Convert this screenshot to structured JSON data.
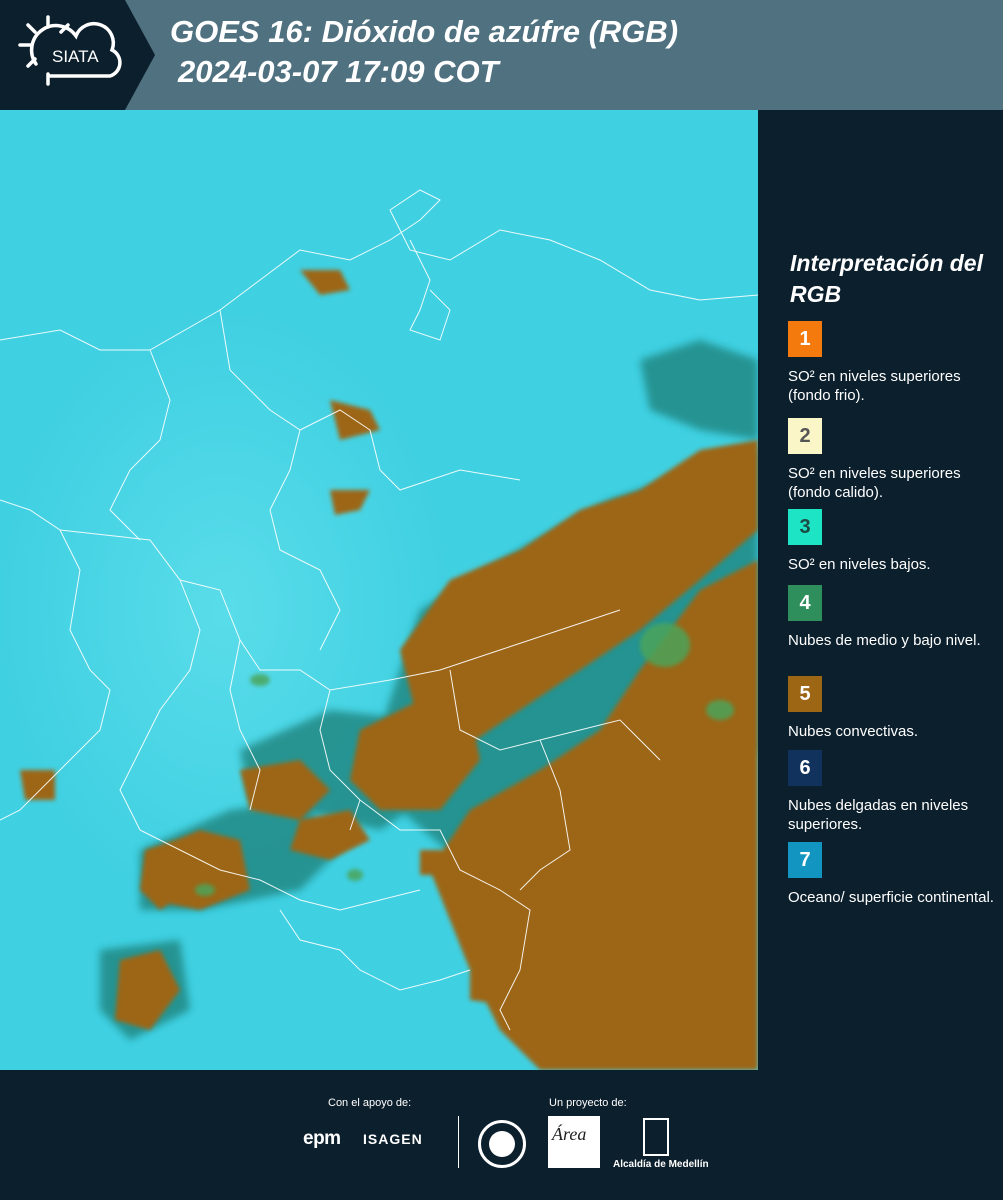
{
  "header": {
    "logo_text": "SIATA",
    "title_line1": "GOES 16: Dióxido de azúfre (RGB)",
    "title_line2": "2024-03-07 17:09 COT"
  },
  "legend": {
    "title": "Interpretación del RGB",
    "items": [
      {
        "number": "1",
        "color": "#f47a0e",
        "number_color": "#ffffff",
        "text": "SO² en niveles superiores (fondo frio)."
      },
      {
        "number": "2",
        "color": "#fbf6c8",
        "number_color": "#555555",
        "text": "SO² en niveles superiores (fondo calido)."
      },
      {
        "number": "3",
        "color": "#1de4c5",
        "number_color": "#1c4a44",
        "text": "SO² en niveles bajos."
      },
      {
        "number": "4",
        "color": "#2f8f5c",
        "number_color": "#ffffff",
        "text": "Nubes de medio y bajo nivel."
      },
      {
        "number": "5",
        "color": "#9c6614",
        "number_color": "#ffffff",
        "text": "Nubes convectivas."
      },
      {
        "number": "6",
        "color": "#12325e",
        "number_color": "#ffffff",
        "text": "Nubes delgadas en niveles superiores."
      },
      {
        "number": "7",
        "color": "#1295c0",
        "number_color": "#ffffff",
        "text": "Oceano/ superficie continental."
      }
    ]
  },
  "footer": {
    "support_label": "Con el apoyo de:",
    "project_label": "Un proyecto de:",
    "sponsor_epm": "epm",
    "sponsor_isagen": "ISAGEN",
    "partner_area": "Área",
    "partner_alcaldia": "Alcaldía de Medellín"
  },
  "colors": {
    "background": "#0c1f2c",
    "header_band": "#4f7180",
    "map_sky": "#3fd0e2",
    "convective_cloud": "#9c6614",
    "mid_low_cloud": "#2f8f5c"
  }
}
